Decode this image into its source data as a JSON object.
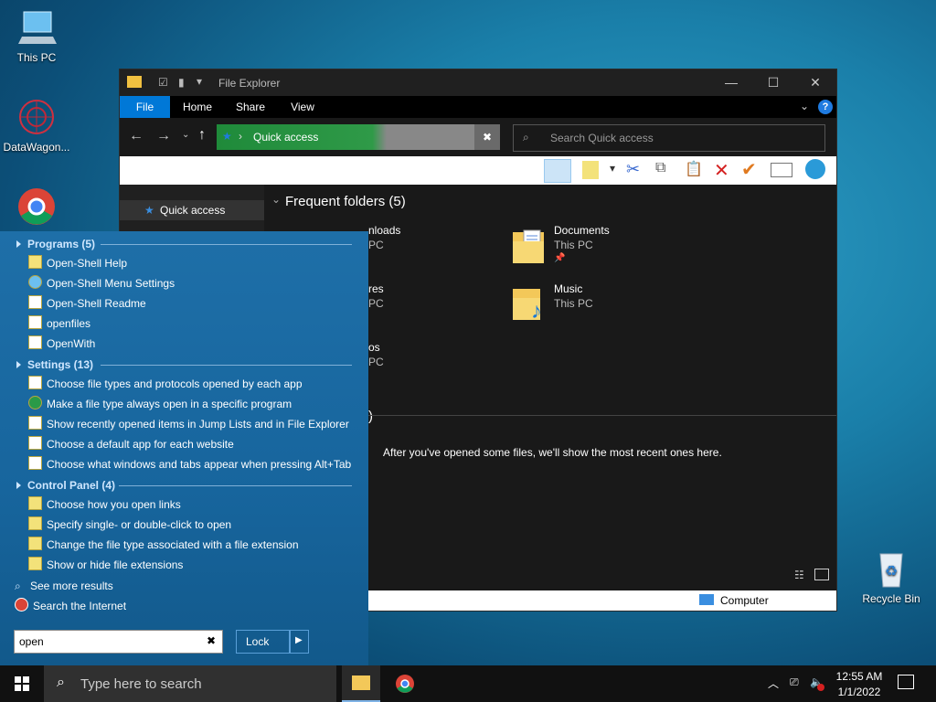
{
  "desktop": {
    "icons": [
      {
        "label": "This PC"
      },
      {
        "label": "DataWagon..."
      },
      {
        "label": "Recycle Bin"
      }
    ]
  },
  "explorer": {
    "title": "File Explorer",
    "tabs": [
      "File",
      "Home",
      "Share",
      "View"
    ],
    "address": "Quick access",
    "search_placeholder": "Search Quick access",
    "nav_quick_access": "Quick access",
    "frequent_header": "Frequent folders (5)",
    "folders": [
      {
        "name": "nloads",
        "sub": "PC"
      },
      {
        "name": "Documents",
        "sub": "This PC"
      },
      {
        "name": "res",
        "sub": "PC"
      },
      {
        "name": "Music",
        "sub": "This PC"
      },
      {
        "name": "os",
        "sub": "PC"
      }
    ],
    "recent_header_fragment": ")",
    "recent_empty": "After you've opened some files, we'll show the most recent ones here.",
    "status_computer": "Computer",
    "accent": "#0078d7"
  },
  "startmenu": {
    "sections": [
      {
        "title": "Programs (5)",
        "items": [
          "Open-Shell Help",
          "Open-Shell Menu Settings",
          "Open-Shell Readme",
          "openfiles",
          "OpenWith"
        ]
      },
      {
        "title": "Settings (13)",
        "items": [
          "Choose file types and protocols opened by each app",
          "Make a file type always open in a specific program",
          "Show recently opened items in Jump Lists and in File Explorer",
          "Choose a default app for each website",
          "Choose what windows and tabs appear when pressing Alt+Tab"
        ]
      },
      {
        "title": "Control Panel (4)",
        "items": [
          "Choose how you open links",
          "Specify single- or double-click to open",
          "Change the file type associated with a file extension",
          "Show or hide file extensions"
        ]
      }
    ],
    "see_more": "See more results",
    "search_internet": "Search the Internet",
    "search_value": "open",
    "lock_label": "Lock"
  },
  "taskbar": {
    "search_placeholder": "Type here to search",
    "time": "12:55 AM",
    "date": "1/1/2022"
  }
}
